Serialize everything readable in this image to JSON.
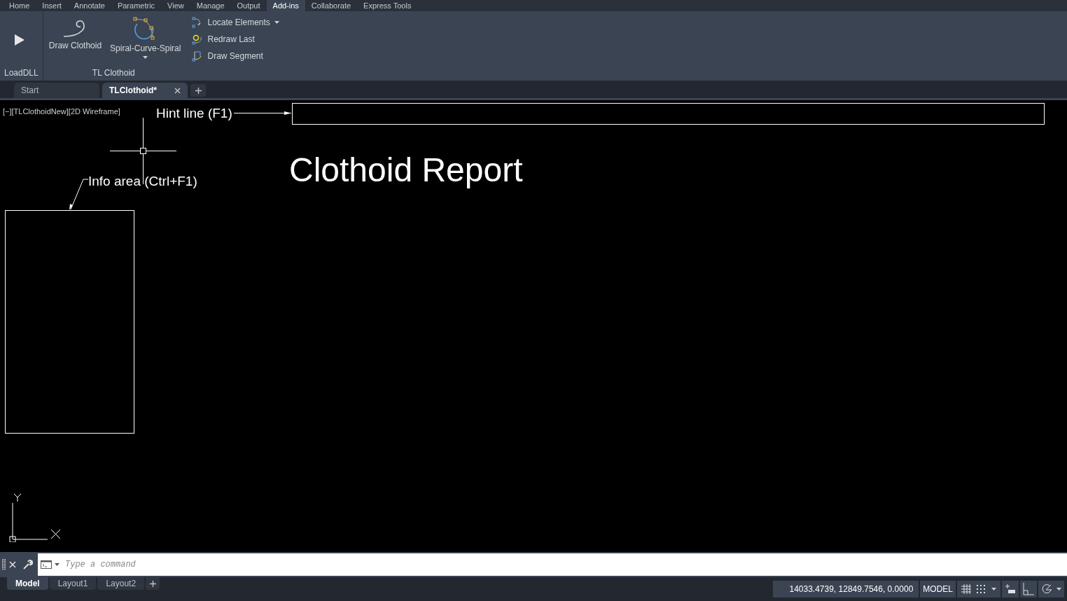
{
  "ribbon_tabs": [
    {
      "label": "Home",
      "selected": false
    },
    {
      "label": "Insert",
      "selected": false
    },
    {
      "label": "Annotate",
      "selected": false
    },
    {
      "label": "Parametric",
      "selected": false
    },
    {
      "label": "View",
      "selected": false
    },
    {
      "label": "Manage",
      "selected": false
    },
    {
      "label": "Output",
      "selected": false
    },
    {
      "label": "Add-ins",
      "selected": true
    },
    {
      "label": "Collaborate",
      "selected": false
    },
    {
      "label": "Express Tools",
      "selected": false
    }
  ],
  "ribbon_panels": [
    {
      "title": "LoadDLL",
      "large_buttons": [
        {
          "has_menu": false
        }
      ]
    },
    {
      "title": "TL Clothoid",
      "large_buttons": [
        {
          "label": "Draw Clothoid",
          "has_menu": false
        },
        {
          "label": "Spiral-Curve-Spiral",
          "has_menu": true
        }
      ],
      "small_buttons": [
        {
          "label": "Locate Elements",
          "has_menu": true
        },
        {
          "label": "Redraw Last",
          "has_menu": false
        },
        {
          "label": "Draw Segment",
          "has_menu": false
        }
      ]
    }
  ],
  "doc_tabs": [
    {
      "label": "Start",
      "selected": false,
      "closable": false
    },
    {
      "label": "TLClothoid*",
      "selected": true,
      "closable": true
    }
  ],
  "viewport": {
    "label": "[−][TLClothoidNew][2D Wireframe]",
    "hint_label": "Hint line (F1)",
    "info_label": "Info area (Ctrl+F1)",
    "title": "Clothoid Report"
  },
  "command_line": {
    "placeholder": "Type a command"
  },
  "layout_tabs": [
    {
      "label": "Model",
      "selected": true
    },
    {
      "label": "Layout1",
      "selected": false
    },
    {
      "label": "Layout2",
      "selected": false
    }
  ],
  "status_bar": {
    "coordinates": "14033.4739, 12849.7546, 0.0000",
    "space": "MODEL"
  }
}
